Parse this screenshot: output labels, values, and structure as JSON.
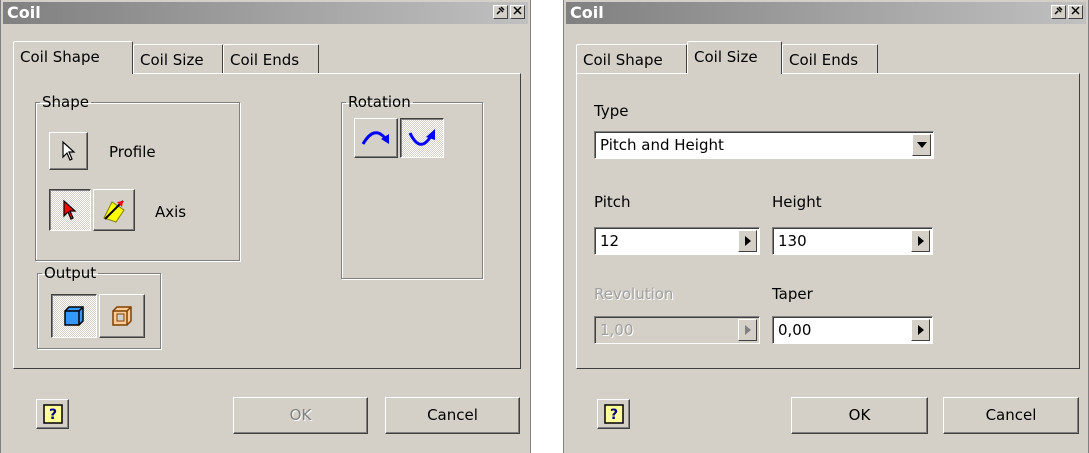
{
  "dialog_left": {
    "title": "Coil",
    "tabs": [
      "Coil Shape",
      "Coil Size",
      "Coil Ends"
    ],
    "active_tab": "Coil Shape",
    "shape_group": {
      "label": "Shape",
      "profile_label": "Profile",
      "axis_label": "Axis"
    },
    "rotation_group": {
      "label": "Rotation"
    },
    "output_group": {
      "label": "Output"
    },
    "ok_label": "OK",
    "cancel_label": "Cancel"
  },
  "dialog_right": {
    "title": "Coil",
    "tabs": [
      "Coil Shape",
      "Coil Size",
      "Coil Ends"
    ],
    "active_tab": "Coil Size",
    "type_label": "Type",
    "type_value": "Pitch and Height",
    "pitch_label": "Pitch",
    "pitch_value": "12",
    "height_label": "Height",
    "height_value": "130",
    "revolution_label": "Revolution",
    "revolution_value": "1,00",
    "taper_label": "Taper",
    "taper_value": "0,00",
    "ok_label": "OK",
    "cancel_label": "Cancel"
  },
  "colors": {
    "dialog_bg": "#d4d0c8",
    "title_gradient_start": "#808080",
    "rotation_arrow": "#0000ff",
    "help_icon_bg": "#ffff99"
  },
  "icons": [
    "pointer-icon",
    "pointer-red-icon",
    "axis-icon",
    "rotate-clockwise-icon",
    "rotate-counterclockwise-icon",
    "solid-output-icon",
    "surface-output-icon",
    "help-icon",
    "dropdown-arrow-icon",
    "spin-arrow-icon",
    "pin-icon",
    "close-icon"
  ]
}
